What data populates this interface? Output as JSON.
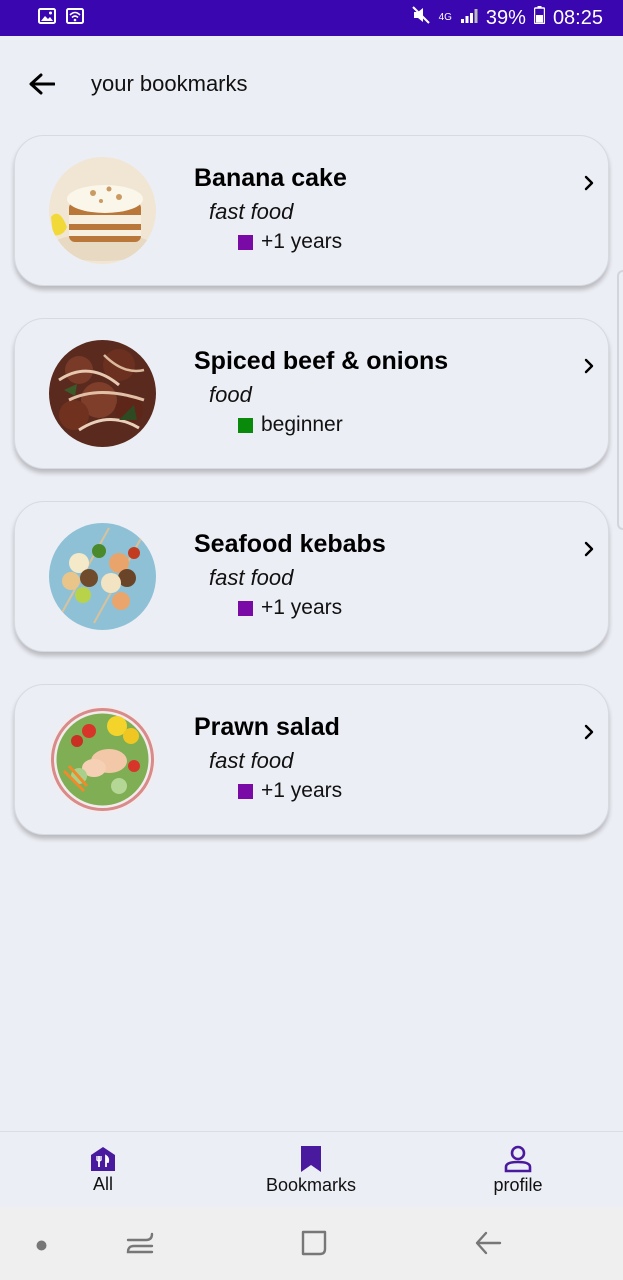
{
  "status_bar": {
    "battery": "39%",
    "time": "08:25",
    "network": "4G",
    "colors": {
      "background": "#3a06b0",
      "foreground": "#ffffff"
    },
    "icons": [
      "image-icon",
      "wifi-hotspot-icon",
      "mute-icon",
      "signal-icon",
      "battery-icon"
    ]
  },
  "header": {
    "title": "your bookmarks",
    "back_icon": "arrow-left-icon"
  },
  "bookmarks": [
    {
      "title": "Banana cake",
      "category": "fast food",
      "level": "+1 years",
      "level_color": "#7a0aa5",
      "image": "banana-cake-photo"
    },
    {
      "title": "Spiced beef & onions",
      "category": "food",
      "level": "beginner",
      "level_color": "#0a8a0a",
      "image": "spiced-beef-photo"
    },
    {
      "title": "Seafood kebabs",
      "category": "fast food",
      "level": "+1 years",
      "level_color": "#7a0aa5",
      "image": "seafood-kebabs-photo"
    },
    {
      "title": "Prawn salad",
      "category": "fast food",
      "level": "+1 years",
      "level_color": "#7a0aa5",
      "image": "prawn-salad-photo"
    }
  ],
  "bottom_nav": {
    "items": [
      {
        "label": "All",
        "icon": "restaurant-icon"
      },
      {
        "label": "Bookmarks",
        "icon": "bookmark-icon"
      },
      {
        "label": "profile",
        "icon": "person-icon"
      }
    ],
    "accent_color": "#4a1a9e"
  },
  "system_nav": {
    "icons": [
      "dot-icon",
      "recents-icon",
      "home-icon",
      "back-icon"
    ]
  }
}
